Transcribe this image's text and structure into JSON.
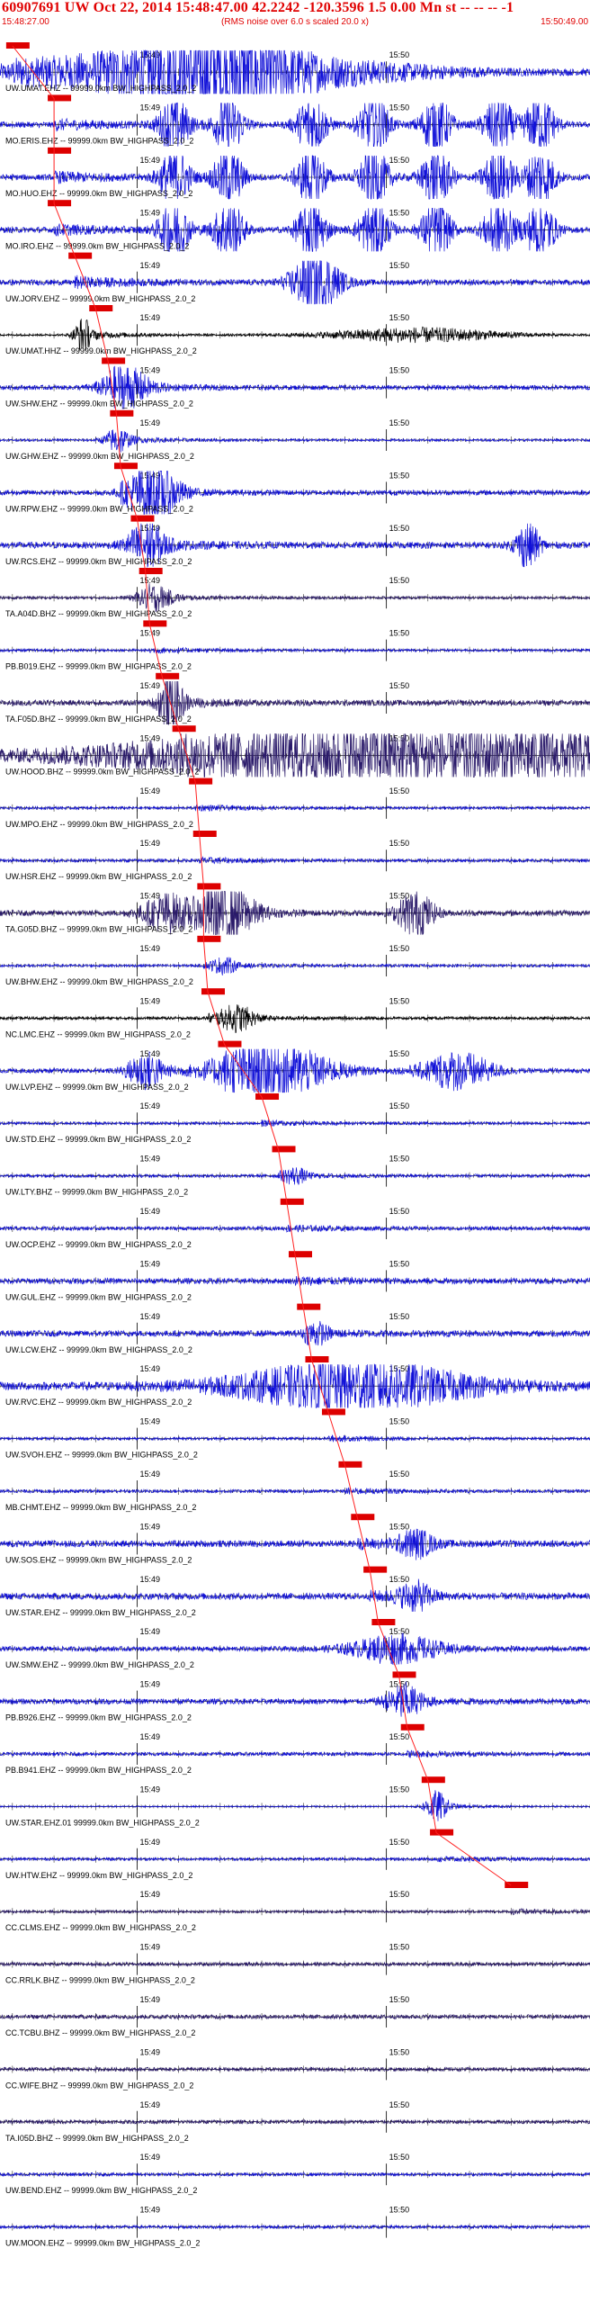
{
  "header": {
    "title": "60907691 UW Oct 22, 2014 15:48:47.00   42.2242 -120.3596  1.5 0.00 Mn st -- -- --  -1",
    "start_time": "15:48:27.00",
    "rms_note": "(RMS noise over 6.0 s scaled 20.0 x)",
    "end_time": "15:50:49.00"
  },
  "colors": {
    "header_text": "#e00000",
    "pick_marker": "#dd0000",
    "pick_line": "#ff2020",
    "axis": "#000000"
  },
  "chart_data": {
    "type": "line",
    "title": "60907691 UW Oct 22, 2014 15:48:47.00   42.2242 -120.3596  1.5 0.00 Mn st -- -- --  -1",
    "x_range": [
      "15:48:27.00",
      "15:50:49.00"
    ],
    "minute_ticks": [
      "15:49",
      "15:50"
    ],
    "grid": false,
    "traces": [
      {
        "label": "UW.UMAT.EHZ -- 99999.0km BW_HIGHPASS_2.0_2",
        "color": "#1010d8",
        "pick_time": "15:48:30",
        "amp": 2.2,
        "n": 0.3,
        "bursts": [
          [
            52,
            10,
            3.8
          ],
          [
            40,
            25,
            1.4
          ],
          [
            60,
            30,
            1.2
          ]
        ]
      },
      {
        "label": "MO.ERIS.EHZ -- 99999.0km BW_HIGHPASS_2.0_2",
        "color": "#1010d8",
        "pick_time": "15:48:40",
        "amp": 1.8,
        "n": 0.35,
        "bursts": [
          [
            42,
            2.5,
            3.5
          ],
          [
            55,
            2.5,
            3.5
          ],
          [
            75,
            2.5,
            3.5
          ],
          [
            90,
            2.5,
            3.5
          ],
          [
            105,
            2.5,
            3.5
          ],
          [
            120,
            2.5,
            3.5
          ],
          [
            130,
            2.5,
            3.5
          ]
        ]
      },
      {
        "label": "MO.HUO.EHZ -- 99999.0km BW_HIGHPASS_2.0_2",
        "color": "#1010d8",
        "pick_time": "15:48:40",
        "amp": 1.8,
        "n": 0.35,
        "bursts": [
          [
            42,
            2.5,
            3.5
          ],
          [
            55,
            2.5,
            3.5
          ],
          [
            75,
            2.5,
            3.5
          ],
          [
            90,
            2.5,
            3.5
          ],
          [
            105,
            2.5,
            3.5
          ],
          [
            120,
            2.5,
            3.5
          ],
          [
            130,
            2.5,
            3.5
          ]
        ]
      },
      {
        "label": "MO.IRO.EHZ -- 99999.0km BW_HIGHPASS_2.0_2",
        "color": "#1010d8",
        "pick_time": "15:48:40",
        "amp": 1.8,
        "n": 0.35,
        "bursts": [
          [
            42,
            2.5,
            3.5
          ],
          [
            55,
            2.5,
            3.5
          ],
          [
            75,
            2.5,
            3.5
          ],
          [
            90,
            2.5,
            3.5
          ],
          [
            105,
            2.5,
            3.5
          ],
          [
            120,
            2.5,
            3.5
          ],
          [
            130,
            2.5,
            3.5
          ]
        ]
      },
      {
        "label": "UW.JORV.EHZ -- 99999.0km BW_HIGHPASS_2.0_2",
        "color": "#1010d8",
        "pick_time": "15:48:45",
        "amp": 2.0,
        "n": 0.3,
        "bursts": [
          [
            76,
            4,
            3.5
          ]
        ]
      },
      {
        "label": "UW.UMAT.HHZ -- 99999.0km BW_HIGHPASS_2.0_2",
        "color": "#000000",
        "pick_time": "15:48:50",
        "amp": 1.3,
        "n": 0.15,
        "bursts": [
          [
            20,
            1.5,
            3
          ],
          [
            100,
            15,
            1.2
          ]
        ]
      },
      {
        "label": "UW.SHW.EHZ -- 99999.0km BW_HIGHPASS_2.0_2",
        "color": "#1010d8",
        "pick_time": "15:48:53",
        "amp": 2.0,
        "n": 0.25,
        "bursts": [
          [
            30,
            4,
            2
          ]
        ]
      },
      {
        "label": "UW.GHW.EHZ -- 99999.0km BW_HIGHPASS_2.0_2",
        "color": "#1010d8",
        "pick_time": "15:48:55",
        "amp": 1.3,
        "n": 0.2,
        "bursts": [
          [
            28,
            2,
            2
          ]
        ]
      },
      {
        "label": "UW.RPW.EHZ -- 99999.0km BW_HIGHPASS_2.0_2",
        "color": "#1010d8",
        "pick_time": "15:48:56",
        "amp": 2.2,
        "n": 0.25,
        "bursts": [
          [
            37,
            4,
            3
          ]
        ]
      },
      {
        "label": "UW.RCS.EHZ -- 99999.0km BW_HIGHPASS_2.0_2",
        "color": "#1010d8",
        "pick_time": "15:49:00",
        "amp": 2.0,
        "n": 0.35,
        "bursts": [
          [
            35,
            3,
            2.5
          ],
          [
            127,
            2,
            2.5
          ]
        ]
      },
      {
        "label": "TA.A04D.BHZ -- 99999.0km BW_HIGHPASS_2.0_2",
        "color": "#2a1a6a",
        "pick_time": "15:49:02",
        "amp": 1.2,
        "n": 0.25,
        "bursts": [
          [
            37,
            3,
            2
          ]
        ]
      },
      {
        "label": "PB.B019.EHZ -- 99999.0km BW_HIGHPASS_2.0_2",
        "color": "#1010d8",
        "pick_time": "15:49:03",
        "amp": 1.0,
        "n": 0.3,
        "bursts": []
      },
      {
        "label": "TA.F05D.BHZ -- 99999.0km BW_HIGHPASS_2.0_2",
        "color": "#2a1a6a",
        "pick_time": "15:49:06",
        "amp": 2.0,
        "n": 0.3,
        "bursts": [
          [
            41,
            2,
            3
          ]
        ]
      },
      {
        "label": "UW.HOOD.BHZ -- 99999.0km BW_HIGHPASS_2.0_2",
        "color": "#2a1a6a",
        "pick_time": "15:49:10",
        "amp": 2.2,
        "n": 0.05,
        "bursts": [
          [
            100,
            55,
            3
          ]
        ]
      },
      {
        "label": "UW.MPO.EHZ -- 99999.0km BW_HIGHPASS_2.0_2",
        "color": "#1010d8",
        "pick_time": "15:49:14",
        "amp": 1.0,
        "n": 0.3,
        "bursts": []
      },
      {
        "label": "UW.HSR.EHZ -- 99999.0km BW_HIGHPASS_2.0_2",
        "color": "#1010d8",
        "pick_time": "15:49:15",
        "amp": 1.0,
        "n": 0.35,
        "bursts": []
      },
      {
        "label": "TA.G05D.BHZ -- 99999.0km BW_HIGHPASS_2.0_2",
        "color": "#2a1a6a",
        "pick_time": "15:49:16",
        "amp": 2.0,
        "n": 0.3,
        "bursts": [
          [
            54,
            5,
            3
          ],
          [
            40,
            4,
            2
          ],
          [
            100,
            3,
            2.5
          ]
        ]
      },
      {
        "label": "UW.BHW.EHZ -- 99999.0km BW_HIGHPASS_2.0_2",
        "color": "#1010d8",
        "pick_time": "15:49:16",
        "amp": 1.0,
        "n": 0.3,
        "bursts": [
          [
            54,
            2,
            1.5
          ]
        ]
      },
      {
        "label": "NC.LMC.EHZ -- 99999.0km BW_HIGHPASS_2.0_2",
        "color": "#000000",
        "pick_time": "15:49:17",
        "amp": 1.3,
        "n": 0.25,
        "bursts": [
          [
            57,
            3,
            2
          ]
        ]
      },
      {
        "label": "UW.LVP.EHZ -- 99999.0km BW_HIGHPASS_2.0_2",
        "color": "#1010d8",
        "pick_time": "15:49:21",
        "amp": 2.0,
        "n": 0.25,
        "bursts": [
          [
            35,
            3,
            2
          ],
          [
            65,
            10,
            3
          ],
          [
            110,
            6,
            2
          ]
        ]
      },
      {
        "label": "UW.STD.EHZ -- 99999.0km BW_HIGHPASS_2.0_2",
        "color": "#1010d8",
        "pick_time": "15:49:30",
        "amp": 1.0,
        "n": 0.3,
        "bursts": []
      },
      {
        "label": "UW.LTY.BHZ -- 99999.0km BW_HIGHPASS_2.0_2",
        "color": "#1010d8",
        "pick_time": "15:49:34",
        "amp": 1.0,
        "n": 0.35,
        "bursts": [
          [
            71,
            2,
            1.5
          ]
        ]
      },
      {
        "label": "UW.OCP.EHZ -- 99999.0km BW_HIGHPASS_2.0_2",
        "color": "#1010d8",
        "pick_time": "15:49:36",
        "amp": 1.0,
        "n": 0.4,
        "bursts": []
      },
      {
        "label": "UW.GUL.EHZ -- 99999.0km BW_HIGHPASS_2.0_2",
        "color": "#1010d8",
        "pick_time": "15:49:38",
        "amp": 1.2,
        "n": 0.5,
        "bursts": []
      },
      {
        "label": "UW.LCW.EHZ -- 99999.0km BW_HIGHPASS_2.0_2",
        "color": "#1010d8",
        "pick_time": "15:49:40",
        "amp": 1.3,
        "n": 0.5,
        "bursts": [
          [
            76,
            2,
            1.5
          ]
        ]
      },
      {
        "label": "UW.RVC.EHZ -- 99999.0km BW_HIGHPASS_2.0_2",
        "color": "#1010d8",
        "pick_time": "15:49:42",
        "amp": 2.0,
        "n": 0.45,
        "bursts": [
          [
            85,
            20,
            2.5
          ]
        ]
      },
      {
        "label": "UW.SVOH.EHZ -- 99999.0km BW_HIGHPASS_2.0_2",
        "color": "#1010d8",
        "pick_time": "15:49:46",
        "amp": 1.0,
        "n": 0.3,
        "bursts": []
      },
      {
        "label": "MB.CHMT.EHZ -- 99999.0km BW_HIGHPASS_2.0_2",
        "color": "#1010d8",
        "pick_time": "15:49:50",
        "amp": 1.0,
        "n": 0.35,
        "bursts": []
      },
      {
        "label": "UW.SOS.EHZ -- 99999.0km BW_HIGHPASS_2.0_2",
        "color": "#1010d8",
        "pick_time": "15:49:53",
        "amp": 1.4,
        "n": 0.5,
        "bursts": [
          [
            100,
            3,
            2
          ]
        ]
      },
      {
        "label": "UW.STAR.EHZ -- 99999.0km BW_HIGHPASS_2.0_2",
        "color": "#1010d8",
        "pick_time": "15:49:56",
        "amp": 1.4,
        "n": 0.5,
        "bursts": [
          [
            100,
            3,
            2
          ]
        ]
      },
      {
        "label": "UW.SMW.EHZ -- 99999.0km BW_HIGHPASS_2.0_2",
        "color": "#1010d8",
        "pick_time": "15:49:58",
        "amp": 1.3,
        "n": 0.4,
        "bursts": [
          [
            95,
            8,
            2
          ]
        ]
      },
      {
        "label": "PB.B926.EHZ -- 99999.0km BW_HIGHPASS_2.0_2",
        "color": "#1010d8",
        "pick_time": "15:50:03",
        "amp": 1.3,
        "n": 0.45,
        "bursts": [
          [
            97,
            3,
            2.5
          ]
        ]
      },
      {
        "label": "PB.B941.EHZ -- 99999.0km BW_HIGHPASS_2.0_2",
        "color": "#1010d8",
        "pick_time": "15:50:05",
        "amp": 1.0,
        "n": 0.4,
        "bursts": []
      },
      {
        "label": "UW.STAR.EHZ.01 99999.0km BW_HIGHPASS_2.0_2",
        "color": "#1010d8",
        "pick_time": "15:50:10",
        "amp": 1.0,
        "n": 0.15,
        "bursts": [
          [
            105,
            2,
            3
          ]
        ]
      },
      {
        "label": "UW.HTW.EHZ -- 99999.0km BW_HIGHPASS_2.0_2",
        "color": "#1010d8",
        "pick_time": "15:50:12",
        "amp": 1.0,
        "n": 0.3,
        "bursts": []
      },
      {
        "label": "CC.CLMS.EHZ -- 99999.0km BW_HIGHPASS_2.0_2",
        "color": "#2a1a6a",
        "pick_time": "15:50:30",
        "amp": 1.0,
        "n": 0.3,
        "bursts": []
      },
      {
        "label": "CC.RRLK.BHZ -- 99999.0km BW_HIGHPASS_2.0_2",
        "color": "#2a1a6a",
        "pick_time": "",
        "amp": 1.0,
        "n": 0.4,
        "bursts": []
      },
      {
        "label": "CC.TCBU.BHZ -- 99999.0km BW_HIGHPASS_2.0_2",
        "color": "#2a1a6a",
        "pick_time": "",
        "amp": 1.0,
        "n": 0.45,
        "bursts": []
      },
      {
        "label": "CC.WIFE.BHZ -- 99999.0km BW_HIGHPASS_2.0_2",
        "color": "#2a1a6a",
        "pick_time": "",
        "amp": 1.0,
        "n": 0.4,
        "bursts": []
      },
      {
        "label": "TA.I05D.BHZ -- 99999.0km BW_HIGHPASS_2.0_2",
        "color": "#2a1a6a",
        "pick_time": "",
        "amp": 1.0,
        "n": 0.4,
        "bursts": []
      },
      {
        "label": "UW.BEND.EHZ -- 99999.0km BW_HIGHPASS_2.0_2",
        "color": "#1010d8",
        "pick_time": "",
        "amp": 1.0,
        "n": 0.35,
        "bursts": []
      },
      {
        "label": "UW.MOON.EHZ -- 99999.0km BW_HIGHPASS_2.0_2",
        "color": "#1010d8",
        "pick_time": "",
        "amp": 1.0,
        "n": 0.35,
        "bursts": []
      }
    ]
  }
}
